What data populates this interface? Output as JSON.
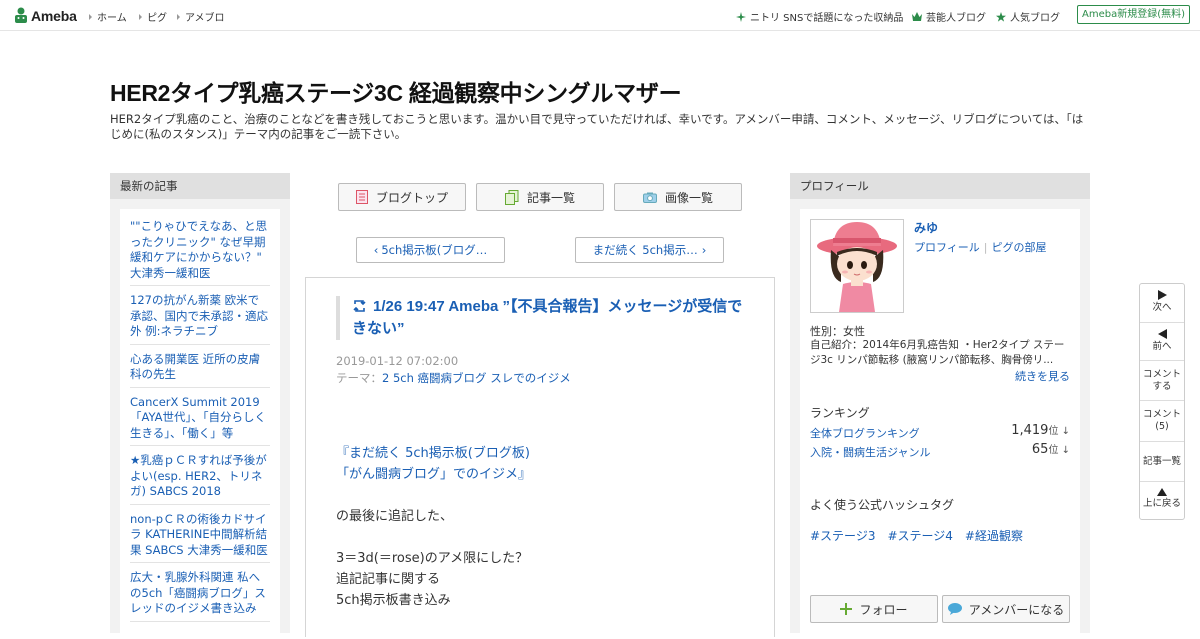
{
  "topbar": {
    "logo_text": "Ameba",
    "nav": [
      "ホーム",
      "ピグ",
      "アメブロ"
    ],
    "right_links": [
      "ニトリ SNSで話題になった収納品",
      "芸能人ブログ",
      "人気ブログ"
    ],
    "signup": "Ameba新規登録(無料)"
  },
  "header": {
    "title": "HER2タイプ乳癌ステージ3C 経過観察中シングルマザー",
    "description": "HER2タイプ乳癌のこと、治療のことなどを書き残しておこうと思います。温かい目で見守っていただければ、幸いです。アメンバー申請、コメント、メッセージ、リブログについては、「はじめに(私のスタンス)」テーマ内の記事をご一読下さい。"
  },
  "left": {
    "heading": "最新の記事",
    "items": [
      "\"\"こりゃひでえなあ、と思ったクリニック\" なぜ早期緩和ケアにかからない？\" 大津秀一緩和医",
      "127の抗がん新薬 欧米で承認、国内で未承認・適応外 例:ネラチニブ",
      "心ある開業医 近所の皮膚科の先生",
      "CancerX Summit 2019「AYA世代」、「自分らしく生きる」、「働く」等",
      "★乳癌ｐＣＲすれば予後がよい(esp. HER2、トリネガ) SABCS 2018",
      "non-pＣＲの術後カドサイラ KATHERINE中間解析結果 SABCS 大津秀一緩和医",
      "広大・乳腺外科関連 私への5ch「癌闘病ブログ」スレッドのイジメ書き込み"
    ]
  },
  "center": {
    "tabs": [
      "ブログトップ",
      "記事一覧",
      "画像一覧"
    ],
    "prev": "5ch掲示板(ブログ…",
    "next": "まだ続く 5ch掲示…",
    "article": {
      "title": "1/26 19:47 Ameba ”【不具合報告】メッセージが受信できない”",
      "date": "2019-01-12 07:02:00",
      "theme_label": "テーマ：",
      "theme": "2 5ch 癌闘病ブログ スレでのイジメ",
      "link_line1": "『まだ続く 5ch掲示板(ブログ板)",
      "link_line2": "「がん闘病ブログ」でのイジメ』",
      "line3": "の最後に追記した、",
      "line4": "3＝3d(＝rose)のアメ限にした？",
      "line5": "追記記事に関する",
      "line6": "5ch掲示板書き込み"
    }
  },
  "right": {
    "heading": "プロフィール",
    "name": "みゆ",
    "link_profile": "プロフィール",
    "link_pigg": "ピグの部屋",
    "sex": "性別：女性",
    "intro": "自己紹介：2014年6月乳癌告知 ・Her2タイプ ステージ3c リンパ節転移 (腋窩リンパ節転移、胸骨傍リ...",
    "more": "続きを見る",
    "ranking_title": "ランキング",
    "rankings": [
      {
        "label": "全体ブログランキング",
        "value": "1,419",
        "unit": "位"
      },
      {
        "label": "入院・闘病生活ジャンル",
        "value": "65",
        "unit": "位"
      }
    ],
    "hashtag_title": "よく使う公式ハッシュタグ",
    "tags": [
      "#ステージ3",
      "#ステージ4",
      "#経過観察"
    ],
    "follow": "フォロー",
    "amember": "アメンバーになる"
  },
  "float": {
    "next": "次へ",
    "prev": "前へ",
    "comment1": "コメント",
    "comment2": "する",
    "comment_count1": "コメント",
    "comment_count2": "(5)",
    "list": "記事一覧",
    "top": "上に戻る"
  },
  "colors": {
    "link": "#1a5fb4",
    "brand_green": "#2c8c4a"
  }
}
